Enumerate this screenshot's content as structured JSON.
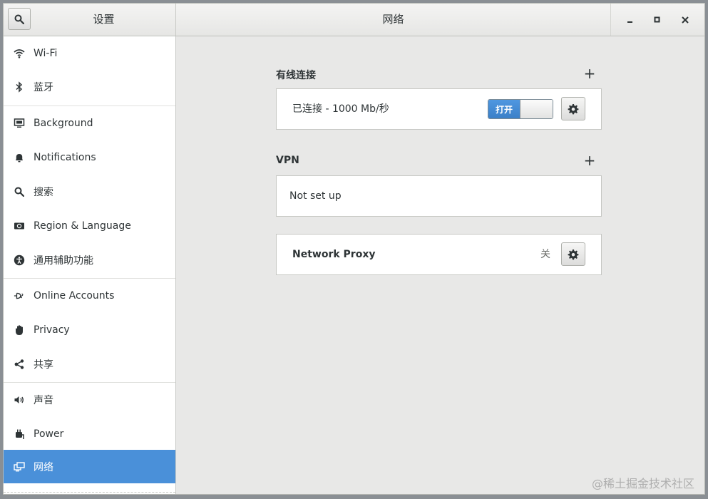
{
  "header": {
    "sidebar_title": "设置",
    "main_title": "网络",
    "minimize_label": "–",
    "maximize_label": "□",
    "close_label": "×"
  },
  "sidebar": {
    "items": [
      {
        "label": "Wi-Fi",
        "icon": "wifi-icon"
      },
      {
        "label": "蓝牙",
        "icon": "bluetooth-icon"
      },
      {
        "label": "Background",
        "icon": "background-icon"
      },
      {
        "label": "Notifications",
        "icon": "bell-icon"
      },
      {
        "label": "搜索",
        "icon": "search-icon"
      },
      {
        "label": "Region & Language",
        "icon": "region-icon"
      },
      {
        "label": "通用辅助功能",
        "icon": "accessibility-icon"
      },
      {
        "label": "Online Accounts",
        "icon": "online-accounts-icon"
      },
      {
        "label": "Privacy",
        "icon": "hand-icon"
      },
      {
        "label": "共享",
        "icon": "share-icon"
      },
      {
        "label": "声音",
        "icon": "speaker-icon"
      },
      {
        "label": "Power",
        "icon": "power-plug-icon"
      },
      {
        "label": "网络",
        "icon": "network-icon",
        "active": true
      }
    ]
  },
  "wired": {
    "title": "有线连接",
    "add_label": "+",
    "status": "已连接 - 1000 Mb/秒",
    "toggle_label": "打开",
    "toggle_on": true
  },
  "vpn": {
    "title": "VPN",
    "add_label": "+",
    "status": "Not set up"
  },
  "proxy": {
    "title": "Network Proxy",
    "status": "关"
  },
  "watermark": "@稀土掘金技术社区",
  "colors": {
    "accent": "#4a90d9",
    "window_bg": "#e8e8e7",
    "card_bg": "#ffffff"
  }
}
